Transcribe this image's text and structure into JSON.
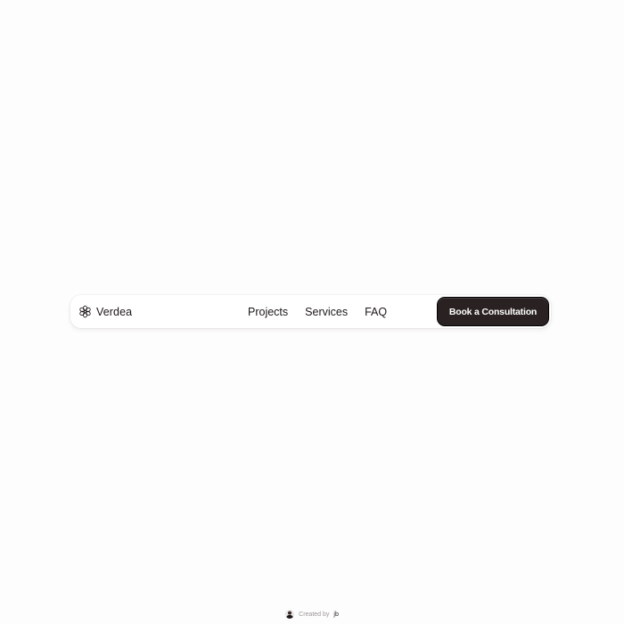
{
  "brand": {
    "name": "Verdea",
    "icon": "flower-icon"
  },
  "nav": {
    "links": [
      {
        "label": "Projects"
      },
      {
        "label": "Services"
      },
      {
        "label": "FAQ"
      }
    ]
  },
  "cta": {
    "label": "Book a Consultation",
    "background": "#2a2122"
  },
  "footer": {
    "created_by": "Created by",
    "author": "jb"
  }
}
